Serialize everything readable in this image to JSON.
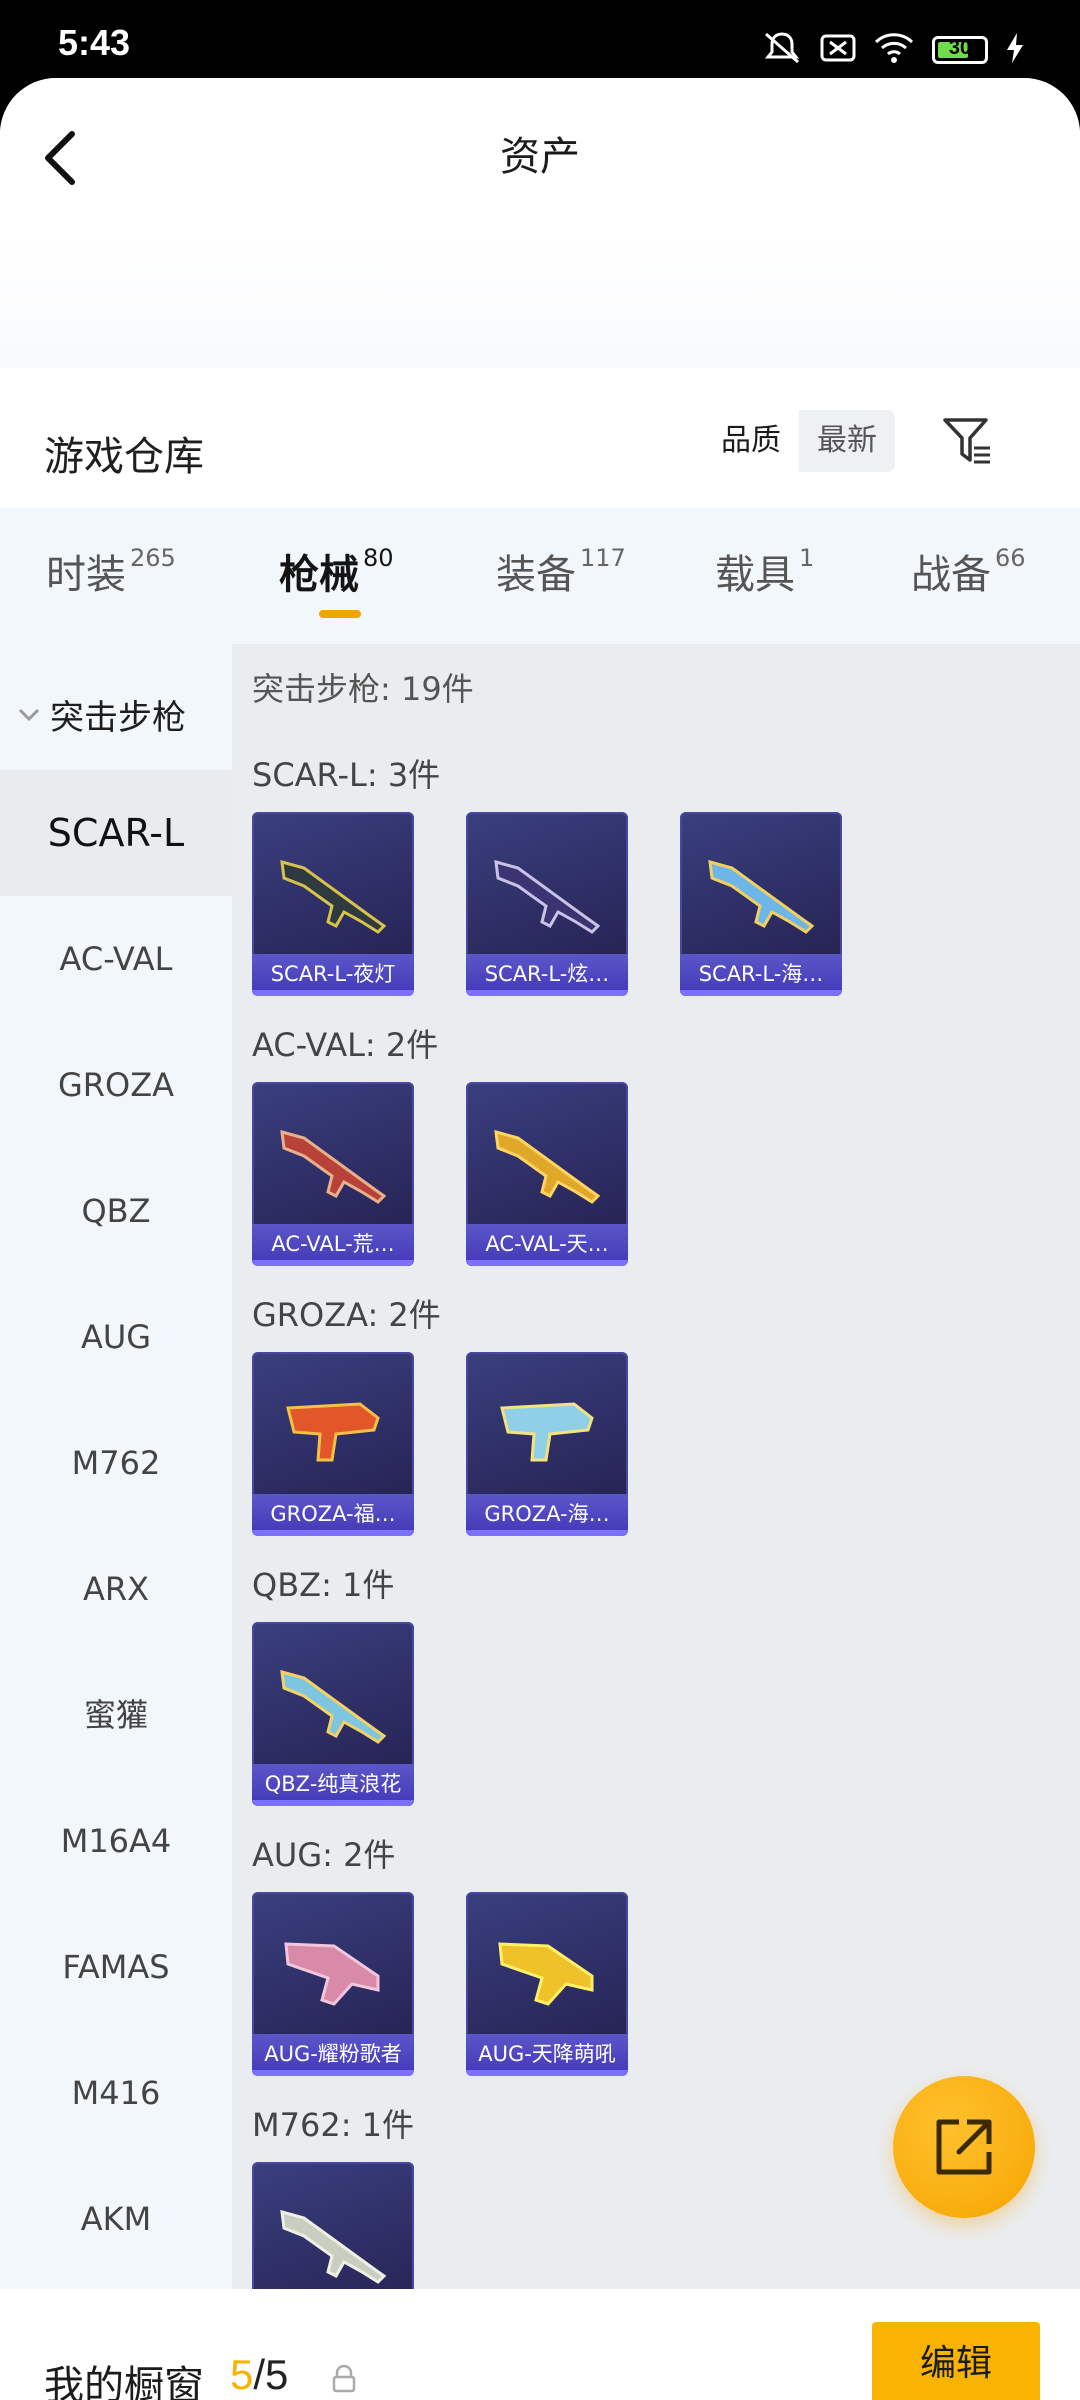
{
  "status": {
    "time": "5:43",
    "battery": "30"
  },
  "header": {
    "title": "资产"
  },
  "warehouse": {
    "title": "游戏仓库",
    "sort_quality": "品质",
    "sort_latest": "最新"
  },
  "tabs": [
    {
      "label": "时装",
      "count": "265"
    },
    {
      "label": "枪械",
      "count": "80"
    },
    {
      "label": "装备",
      "count": "117"
    },
    {
      "label": "载具",
      "count": "1"
    },
    {
      "label": "战备",
      "count": "66"
    }
  ],
  "sidebar": {
    "group": "突击步枪",
    "items": [
      "SCAR-L",
      "AC-VAL",
      "GROZA",
      "QBZ",
      "AUG",
      "M762",
      "ARX",
      "蜜獾",
      "M16A4",
      "FAMAS",
      "M416",
      "AKM"
    ]
  },
  "content": {
    "total": "突击步枪: 19件",
    "groups": [
      {
        "title": "SCAR-L: 3件",
        "items": [
          "SCAR-L-夜灯",
          "SCAR-L-炫…",
          "SCAR-L-海…"
        ]
      },
      {
        "title": "AC-VAL: 2件",
        "items": [
          "AC-VAL-荒…",
          "AC-VAL-天…"
        ]
      },
      {
        "title": "GROZA: 2件",
        "items": [
          "GROZA-福…",
          "GROZA-海…"
        ]
      },
      {
        "title": "QBZ: 1件",
        "items": [
          "QBZ-纯真浪花"
        ]
      },
      {
        "title": "AUG: 2件",
        "items": [
          "AUG-耀粉歌者",
          "AUG-天降萌吼"
        ]
      },
      {
        "title": "M762: 1件",
        "items": [
          ""
        ]
      }
    ]
  },
  "bottom": {
    "showcase_label": "我的橱窗",
    "count_current": "5",
    "count_sep": "/",
    "count_total": "5",
    "edit_label": "编辑"
  },
  "colors": {
    "accent": "#f8b400",
    "card_bg": "#2d2d64",
    "card_bar": "#4338b8"
  }
}
